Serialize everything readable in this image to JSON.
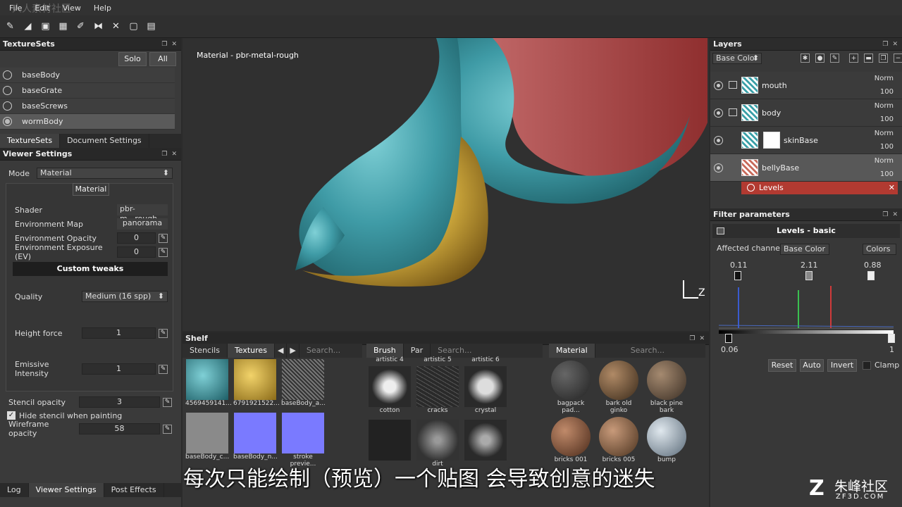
{
  "menu": [
    "File",
    "Edit",
    "View",
    "Help"
  ],
  "texture_sets": {
    "title": "TextureSets",
    "solo": "Solo",
    "all": "All",
    "items": [
      "baseBody",
      "baseGrate",
      "baseScrews",
      "wormBody"
    ],
    "tabs": [
      "TextureSets",
      "Document Settings"
    ]
  },
  "viewer": {
    "title": "Viewer Settings",
    "mode_label": "Mode",
    "mode_value": "Material",
    "material_btn": "Material",
    "shader_label": "Shader",
    "shader_value": "pbr-m...rough",
    "envmap_label": "Environment Map",
    "envmap_value": "panorama",
    "envop_label": "Environment Opacity",
    "envop_value": "0",
    "envexp_label": "Environment Exposure (EV)",
    "envexp_value": "0",
    "custom": "Custom tweaks",
    "quality_label": "Quality",
    "quality_value": "Medium (16 spp)",
    "height_label": "Height force",
    "height_value": "1",
    "emissive_label": "Emissive Intensity",
    "emissive_value": "1",
    "stencil_label": "Stencil opacity",
    "stencil_value": "3",
    "hide_stencil": "Hide stencil when painting",
    "wire_label": "Wireframe opacity",
    "wire_value": "58"
  },
  "bottom_tabs": [
    "Log",
    "Viewer Settings",
    "Post Effects"
  ],
  "viewport": {
    "label": "Material - pbr-metal-rough",
    "axis_z": "Z"
  },
  "shelf": {
    "title": "Shelf",
    "tabs1": [
      "Stencils",
      "Textures"
    ],
    "search": "Search...",
    "search2": "Search...",
    "search3": "Search...",
    "brush": "Brush",
    "par": "Par",
    "material": "Material",
    "textures": [
      "4569459141...",
      "6791921522...",
      "baseBody_a...",
      "baseBody_c...",
      "baseBody_n...",
      "stroke previe..."
    ],
    "brushes_top": [
      "artistic 4",
      "artistic 5",
      "artistic 6"
    ],
    "brushes": [
      "cotton",
      "cracks",
      "crystal",
      "",
      "dirt",
      ""
    ],
    "materials": [
      "bagpack pad...",
      "bark old ginko",
      "black pine bark",
      "bricks 001",
      "bricks 005",
      "bump"
    ]
  },
  "layers": {
    "title": "Layers",
    "channel": "Base Color",
    "items": [
      {
        "name": "mouth",
        "blend": "Norm",
        "opacity": "100"
      },
      {
        "name": "body",
        "blend": "Norm",
        "opacity": "100"
      },
      {
        "name": "skinBase",
        "blend": "Norm",
        "opacity": "100"
      },
      {
        "name": "bellyBase",
        "blend": "Norm",
        "opacity": "100"
      }
    ],
    "filter": "Levels"
  },
  "filter": {
    "title": "Filter parameters",
    "header": "Levels - basic",
    "affected_label": "Affected channel",
    "affected_value": "Base Color",
    "colors": "Colors",
    "in_low": "0.11",
    "in_mid": "2.11",
    "in_high": "0.88",
    "out_low": "0.06",
    "out_high": "1",
    "reset": "Reset",
    "auto": "Auto",
    "invert": "Invert",
    "clamp": "Clamp"
  },
  "subtitle": "每次只能绘制（预览）一个贴图 会导致创意的迷失",
  "watermark": {
    "brand": "朱峰社区",
    "site": "ZF3D.COM",
    "faint": "人人素材社区"
  },
  "colors": {
    "accent_red": "#b23a31",
    "worm_teal": "#3f9ba6",
    "belly_gold": "#c9a43a"
  }
}
